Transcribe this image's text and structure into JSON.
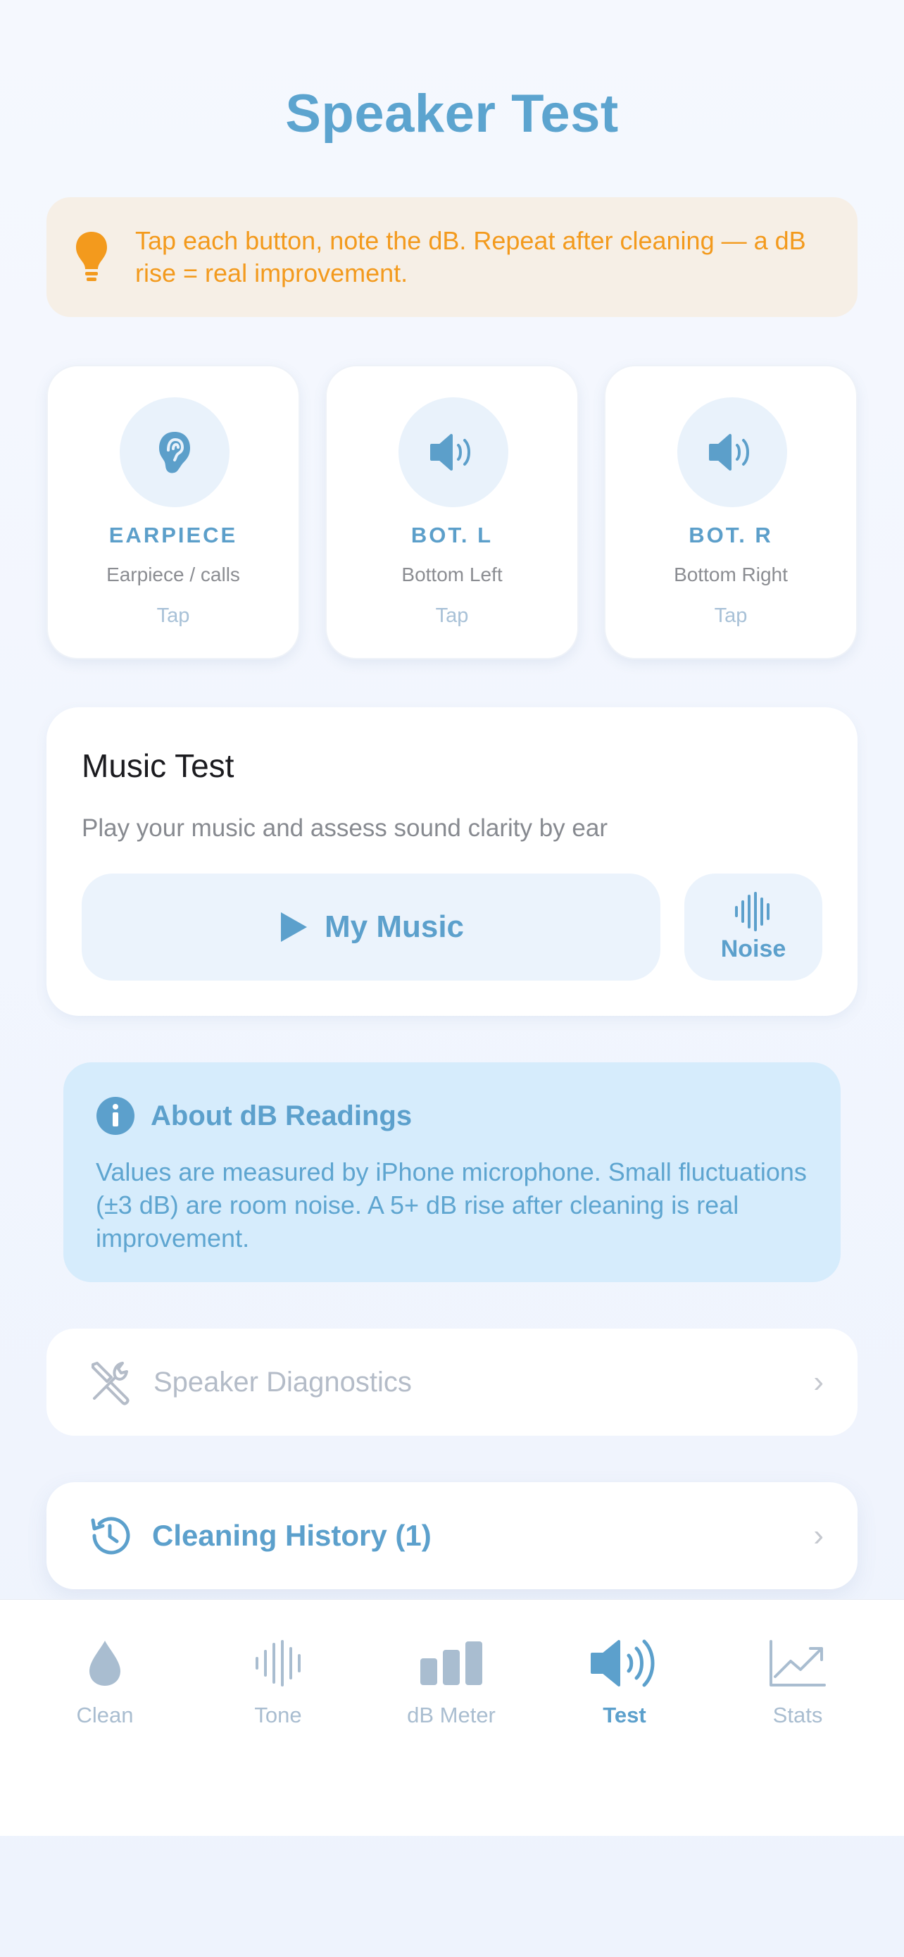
{
  "header": {
    "title": "Speaker Test"
  },
  "tip": {
    "text": "Tap each button, note the dB. Repeat after cleaning — a dB rise = real improvement.",
    "icon": "lightbulb-icon",
    "color": "#f39a1d"
  },
  "speakers": [
    {
      "name": "EARPIECE",
      "desc": "Earpiece / calls",
      "action": "Tap",
      "icon": "ear-icon"
    },
    {
      "name": "BOT. L",
      "desc": "Bottom Left",
      "action": "Tap",
      "icon": "speaker-icon"
    },
    {
      "name": "BOT. R",
      "desc": "Bottom Right",
      "action": "Tap",
      "icon": "speaker-icon"
    }
  ],
  "music": {
    "title": "Music Test",
    "subtitle": "Play your music and assess sound clarity by ear",
    "my_music_label": "My Music",
    "noise_label": "Noise"
  },
  "about": {
    "title": "About dB Readings",
    "text": "Values are measured by iPhone microphone. Small fluctuations (±3 dB) are room noise. A 5+ dB rise after cleaning is real improvement."
  },
  "diagnostics": {
    "label": "Speaker Diagnostics"
  },
  "history": {
    "label": "Cleaning History (1)"
  },
  "tabs": [
    {
      "label": "Clean",
      "icon": "drop-icon",
      "active": false
    },
    {
      "label": "Tone",
      "icon": "waveform-icon",
      "active": false
    },
    {
      "label": "dB Meter",
      "icon": "bars-icon",
      "active": false
    },
    {
      "label": "Test",
      "icon": "speaker-wave-icon",
      "active": true
    },
    {
      "label": "Stats",
      "icon": "chart-icon",
      "active": false
    }
  ],
  "colors": {
    "accent": "#5ca0cc",
    "inactive": "#a9bdd0",
    "tip_bg": "#f6efe6",
    "info_bg": "#d6ecfc"
  }
}
